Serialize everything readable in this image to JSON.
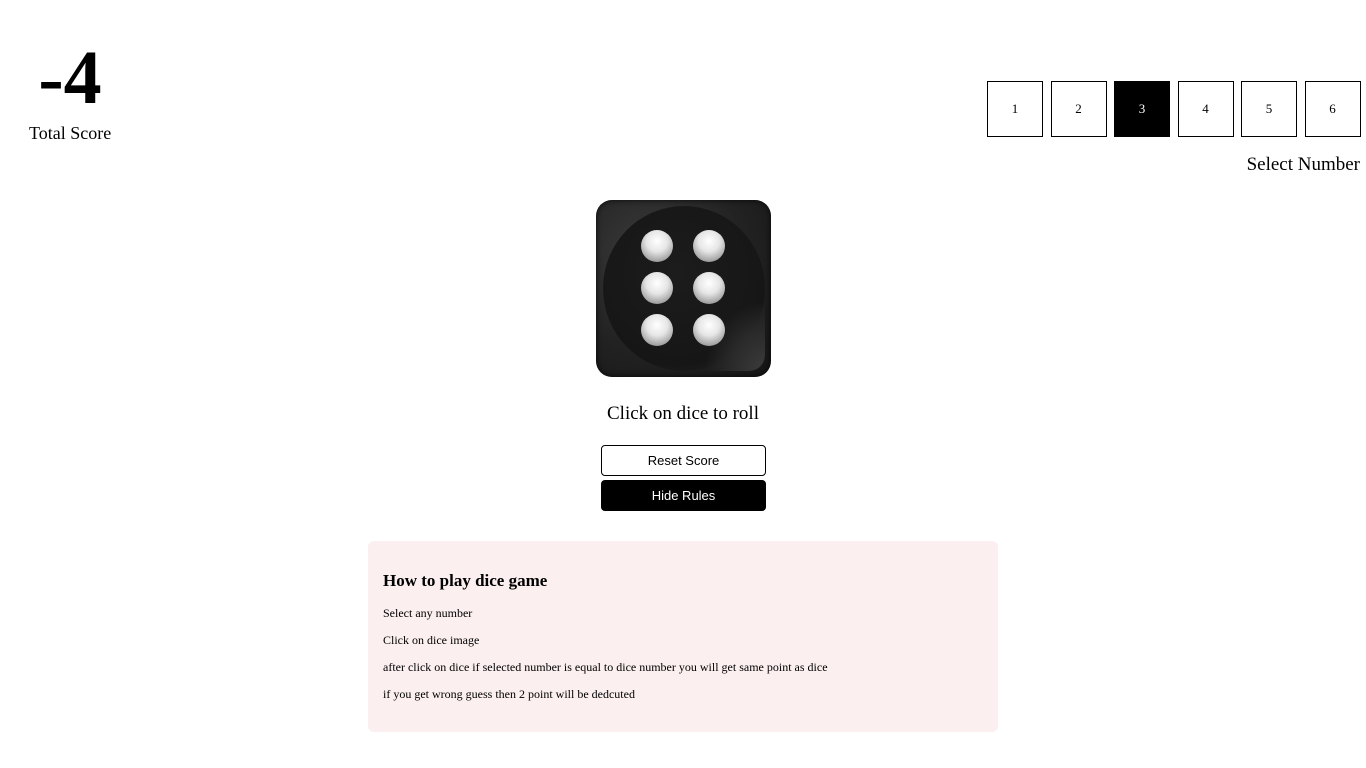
{
  "score": {
    "value": "-4",
    "label": "Total Score"
  },
  "number_selector": {
    "options": [
      "1",
      "2",
      "3",
      "4",
      "5",
      "6"
    ],
    "selected": "3",
    "label": "Select Number"
  },
  "dice": {
    "current_value": 6,
    "hint": "Click on dice to roll"
  },
  "buttons": {
    "reset_label": "Reset Score",
    "rules_label": "Hide Rules"
  },
  "rules": {
    "title": "How to play dice game",
    "lines": [
      "Select any number",
      "Click on dice image",
      "after click on dice if selected number is equal to dice number you will get same point as dice",
      "if you get wrong guess then 2 point will be dedcuted"
    ]
  },
  "colors": {
    "selected_bg": "#000000",
    "rules_bg": "#fbefef",
    "dice_body": "#222222"
  }
}
